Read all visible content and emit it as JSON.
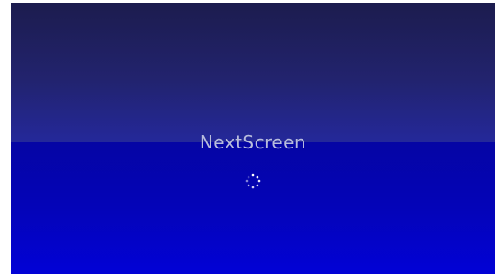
{
  "splash": {
    "app_name": "NextScreen",
    "status_icon": "loading-spinner-icon"
  },
  "colors": {
    "top_band": "#20226a",
    "bottom_band": "#0404b8",
    "title_text": "#b8bcdc",
    "spinner_dots": "#ffffff"
  }
}
